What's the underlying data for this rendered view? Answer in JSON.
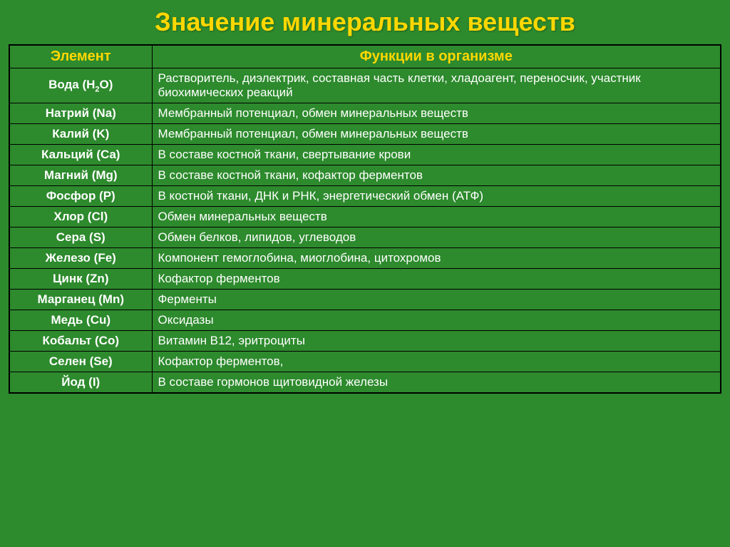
{
  "title": "Значение минеральных веществ",
  "table": {
    "headers": {
      "element": "Элемент",
      "function": "Функции в организме"
    },
    "rows": [
      {
        "element": "Вода (H₂O)",
        "element_html": "Вода (H<sub>2</sub>O)",
        "function": "Растворитель, диэлектрик, составная часть клетки, хладоагент, переносчик, участник биохимических реакций"
      },
      {
        "element": "Натрий (Na)",
        "function": "Мембранный потенциал, обмен минеральных веществ"
      },
      {
        "element": "Калий (K)",
        "function": "Мембранный потенциал, обмен минеральных веществ"
      },
      {
        "element": "Кальций (Ca)",
        "function": "В составе костной ткани, свертывание крови"
      },
      {
        "element": "Магний (Mg)",
        "function": "В составе костной ткани, кофактор ферментов"
      },
      {
        "element": "Фосфор (P)",
        "function": "В костной ткани,  ДНК и РНК, энергетический обмен  (АТФ)"
      },
      {
        "element": "Хлор (Cl)",
        "function": "Обмен минеральных веществ"
      },
      {
        "element": "Сера (S)",
        "function": "Обмен белков, липидов, углеводов"
      },
      {
        "element": "Железо (Fe)",
        "function": "Компонент гемоглобина, миоглобина, цитохромов"
      },
      {
        "element": "Цинк (Zn)",
        "function": "Кофактор ферментов"
      },
      {
        "element": "Марганец (Mn)",
        "function": "Ферменты"
      },
      {
        "element": "Медь (Cu)",
        "function": "Оксидазы"
      },
      {
        "element": "Кобальт (Co)",
        "function": "Витамин В12, эритроциты"
      },
      {
        "element": "Селен (Se)",
        "function": "Кофактор ферментов,"
      },
      {
        "element": "Йод (I)",
        "function": "В составе гормонов щитовидной железы"
      }
    ]
  }
}
